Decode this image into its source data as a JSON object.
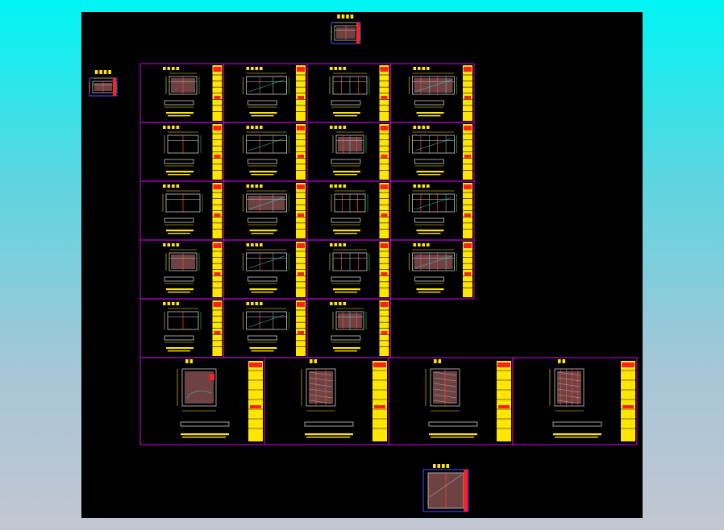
{
  "colors": {
    "canvas_bg": "#000000",
    "frame": "#b000c8",
    "title_block": "#ffe600",
    "accent_red": "#ff2020",
    "elevation_line": "#c8c8c8"
  },
  "drawing": {
    "top_sheet": {
      "id": "top"
    },
    "left_sheet": {
      "id": "left"
    },
    "bottom_sheet": {
      "id": "bottom"
    },
    "grid_rows": 5,
    "grid_cols": 4,
    "grid_cells_present": [
      [
        true,
        true,
        true,
        true
      ],
      [
        true,
        true,
        true,
        true
      ],
      [
        true,
        true,
        true,
        true
      ],
      [
        true,
        true,
        true,
        true
      ],
      [
        true,
        true,
        true,
        false
      ]
    ],
    "large_row_cells": 4
  }
}
